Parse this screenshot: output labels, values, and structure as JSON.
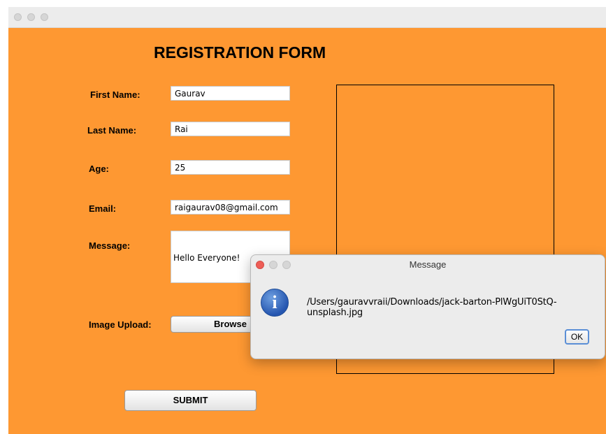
{
  "window": {
    "background_color": "#fe9832"
  },
  "form": {
    "title": "REGISTRATION FORM",
    "first_name": {
      "label": "First Name:",
      "value": "Gaurav"
    },
    "last_name": {
      "label": "Last Name:",
      "value": "Rai"
    },
    "age": {
      "label": "Age:",
      "value": "25"
    },
    "email": {
      "label": "Email:",
      "value": "raigaurav08@gmail.com"
    },
    "message": {
      "label": "Message:",
      "value": "Hello Everyone!"
    },
    "image_upload": {
      "label": "Image Upload:",
      "button": "Browse"
    },
    "submit": "SUBMIT"
  },
  "dialog": {
    "title": "Message",
    "icon": "info-icon",
    "text": "/Users/gauravvraii/Downloads/jack-barton-PlWgUiT0StQ-unsplash.jpg",
    "ok": "OK"
  }
}
